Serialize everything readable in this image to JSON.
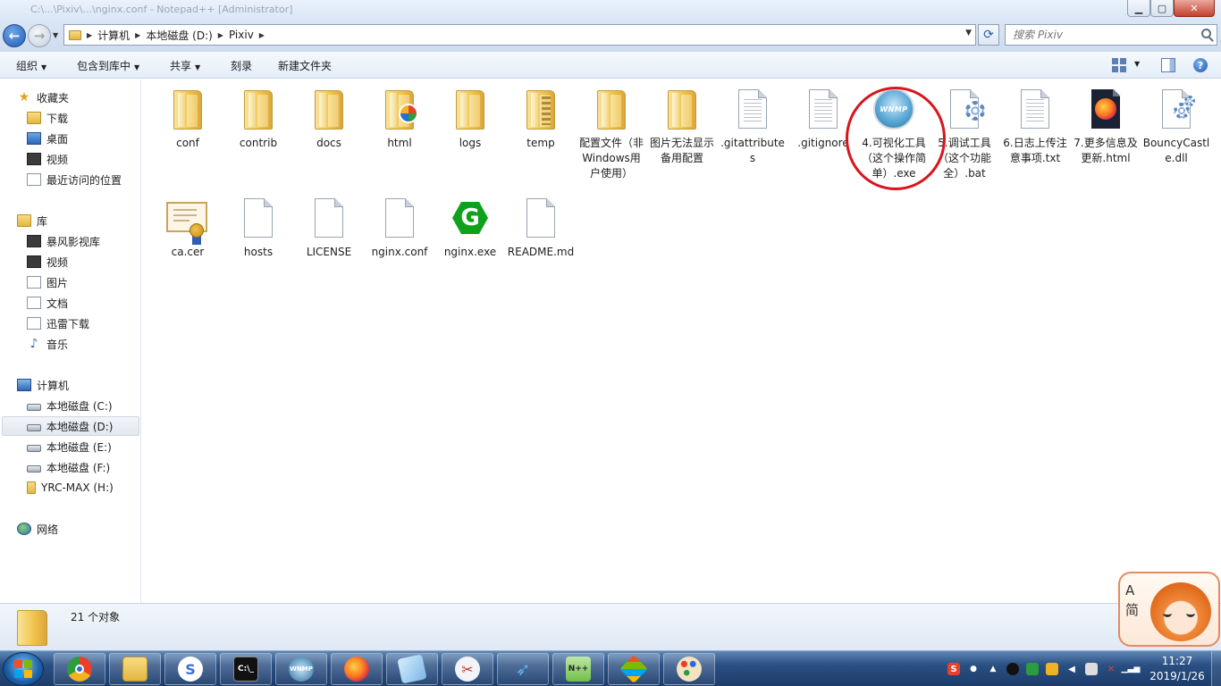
{
  "window": {
    "title": "C:\\...\\Pixiv\\...\\nginx.conf - Notepad++ [Administrator]",
    "controls": {
      "minimize": "▁",
      "maximize": "▢",
      "close": "✕"
    }
  },
  "address": {
    "breadcrumbs": [
      "计算机",
      "本地磁盘 (D:)",
      "Pixiv"
    ],
    "search_placeholder": "搜索 Pixiv"
  },
  "toolbar": {
    "organize": "组织",
    "include_in_library": "包含到库中",
    "share": "共享",
    "burn": "刻录",
    "new_folder": "新建文件夹"
  },
  "sidebar": {
    "favorites": {
      "label": "收藏夹",
      "items": [
        {
          "label": "下载",
          "icon": "download-folder-icon"
        },
        {
          "label": "桌面",
          "icon": "desktop-icon"
        },
        {
          "label": "视频",
          "icon": "video-icon"
        },
        {
          "label": "最近访问的位置",
          "icon": "recent-places-icon"
        }
      ]
    },
    "libraries": {
      "label": "库",
      "items": [
        {
          "label": "暴风影视库",
          "icon": "film-library-icon"
        },
        {
          "label": "视频",
          "icon": "video-library-icon"
        },
        {
          "label": "图片",
          "icon": "pictures-library-icon"
        },
        {
          "label": "文档",
          "icon": "documents-library-icon"
        },
        {
          "label": "迅雷下载",
          "icon": "thunder-download-icon"
        },
        {
          "label": "音乐",
          "icon": "music-library-icon"
        }
      ]
    },
    "computer": {
      "label": "计算机",
      "items": [
        {
          "label": "本地磁盘 (C:)",
          "icon": "drive-icon"
        },
        {
          "label": "本地磁盘 (D:)",
          "icon": "drive-icon",
          "selected": true
        },
        {
          "label": "本地磁盘 (E:)",
          "icon": "drive-icon"
        },
        {
          "label": "本地磁盘 (F:)",
          "icon": "drive-icon"
        },
        {
          "label": "YRC-MAX (H:)",
          "icon": "usb-drive-icon"
        }
      ]
    },
    "network": {
      "label": "网络"
    }
  },
  "files": [
    {
      "name": "conf",
      "type": "folder"
    },
    {
      "name": "contrib",
      "type": "folder"
    },
    {
      "name": "docs",
      "type": "folder"
    },
    {
      "name": "html",
      "type": "folder-chrome"
    },
    {
      "name": "logs",
      "type": "folder"
    },
    {
      "name": "temp",
      "type": "folder-zip"
    },
    {
      "name": "配置文件（非Windows用户使用）",
      "type": "folder"
    },
    {
      "name": "图片无法显示备用配置",
      "type": "folder"
    },
    {
      "name": ".gitattributes",
      "type": "doc"
    },
    {
      "name": ".gitignore",
      "type": "doc"
    },
    {
      "name": "4.可视化工具（这个操作简单）.exe",
      "type": "wnmp"
    },
    {
      "name": "5.调试工具（这个功能全）.bat",
      "type": "bat"
    },
    {
      "name": "6.日志上传注意事项.txt",
      "type": "txt"
    },
    {
      "name": "7.更多信息及更新.html",
      "type": "firefox"
    },
    {
      "name": "BouncyCastle.dll",
      "type": "dll"
    },
    {
      "name": "ca.cer",
      "type": "cert"
    },
    {
      "name": "hosts",
      "type": "blank"
    },
    {
      "name": "LICENSE",
      "type": "blank"
    },
    {
      "name": "nginx.conf",
      "type": "blank"
    },
    {
      "name": "nginx.exe",
      "type": "nginx"
    },
    {
      "name": "README.md",
      "type": "blank"
    }
  ],
  "details": {
    "count_text": "21 个对象"
  },
  "widget": {
    "letters": [
      "A",
      "简"
    ]
  },
  "taskbar": {
    "apps": [
      {
        "name": "chrome",
        "label": ""
      },
      {
        "name": "explorer",
        "label": ""
      },
      {
        "name": "app-s",
        "label": "S"
      },
      {
        "name": "cmd",
        "label": "C:\\_"
      },
      {
        "name": "wnmp",
        "label": "WNMP"
      },
      {
        "name": "firefox",
        "label": ""
      },
      {
        "name": "notepad",
        "label": ""
      },
      {
        "name": "snipping",
        "label": ""
      },
      {
        "name": "app-bird",
        "label": ""
      },
      {
        "name": "notepadpp",
        "label": "N++"
      },
      {
        "name": "app-diamond",
        "label": ""
      },
      {
        "name": "paint",
        "label": ""
      }
    ],
    "clock": {
      "time": "11:27",
      "date": "2019/1/26"
    }
  },
  "colors": {
    "accent": "#2a65b8",
    "annotation": "#d9141e",
    "taskbar": "#2a4f82"
  }
}
